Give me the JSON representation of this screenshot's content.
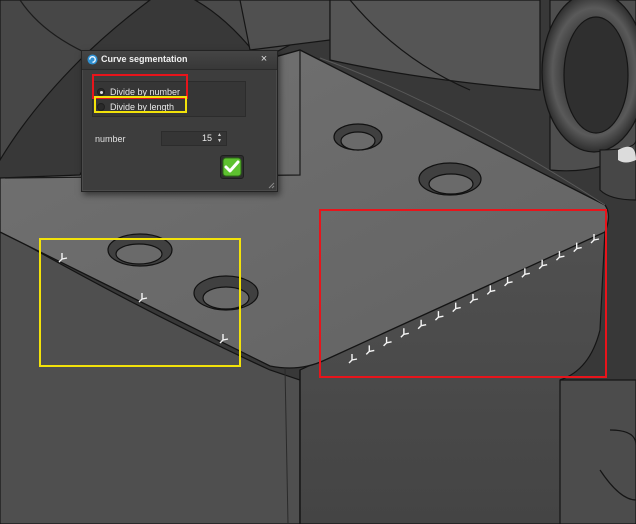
{
  "dialog": {
    "title": "Curve segmentation",
    "close_label": "×",
    "options": [
      {
        "label": "Divide by number",
        "selected": true
      },
      {
        "label": "Divide by length",
        "selected": false
      }
    ],
    "number_label": "number",
    "number_value": "15",
    "spin_up": "▲",
    "spin_down": "▼",
    "confirm_icon": "green-checkmark-icon"
  },
  "annotations": {
    "red_color": "#e8141b",
    "yellow_color": "#f2e20a"
  },
  "scene": {
    "background_color": "#3a3a3a",
    "top_face_color": "#6b6b6b",
    "side_face_color": "#4d4d4d",
    "marker_color": "#f5f5f5",
    "divided_edge_points": 15,
    "sample_edge_points": 3
  }
}
